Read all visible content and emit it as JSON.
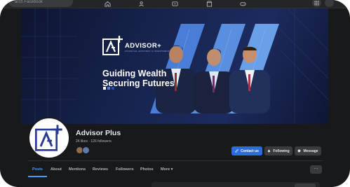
{
  "search": {
    "placeholder": "arch Facebook"
  },
  "cover": {
    "brand_name": "ADVISOR+",
    "brand_tagline": "FINANCIAL ADVISORY & INVESTMENT",
    "headline_line1": "Guiding Wealth",
    "headline_line2": "Securing Futures",
    "accent_colors": [
      "#ffffff",
      "#4c7bd9",
      "#2c4aa1"
    ]
  },
  "page": {
    "name": "Advisor Plus",
    "stats": "24 likes · 126 followers"
  },
  "actions": {
    "contact": "Contact us",
    "following": "Following",
    "message": "Message"
  },
  "tabs": [
    {
      "label": "Posts"
    },
    {
      "label": "About"
    },
    {
      "label": "Mentions"
    },
    {
      "label": "Reviews"
    },
    {
      "label": "Followers"
    },
    {
      "label": "Photos"
    },
    {
      "label": "More ▾"
    }
  ],
  "more_button": "···",
  "colors": {
    "accent": "#2d6cdf",
    "link": "#4599ff",
    "background": "#18191a"
  }
}
